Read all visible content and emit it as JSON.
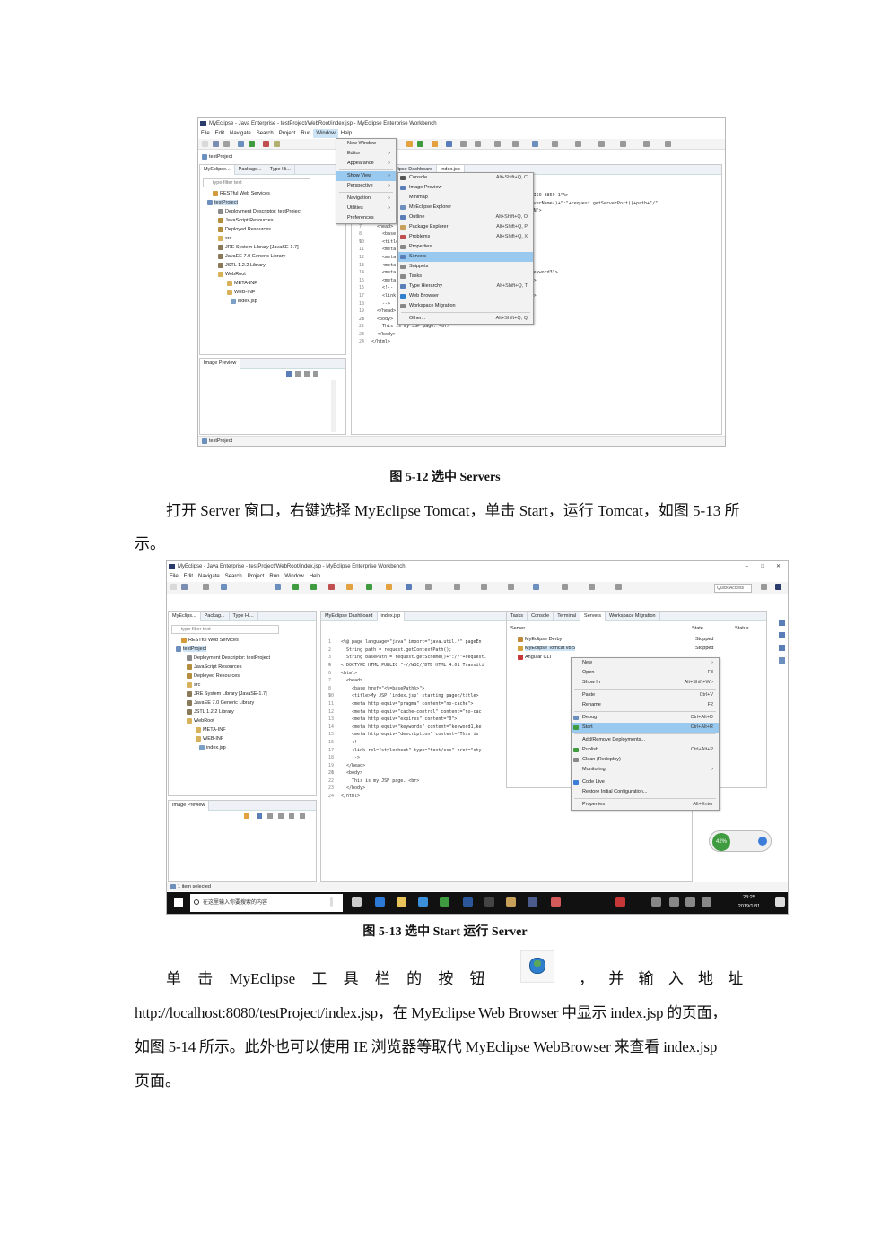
{
  "fig1": {
    "window_title": "MyEclipse - Java Enterprise - testProject/WebRoot/index.jsp - MyEclipse Enterprise Workbench",
    "menus": [
      "File",
      "Edit",
      "Navigate",
      "Search",
      "Project",
      "Run",
      "Window",
      "Help"
    ],
    "breadcrumb": "testProject",
    "explorer_tabs": [
      "MyEclipse...",
      "Package...",
      "Type Hi..."
    ],
    "filter_placeholder": "type filter text",
    "tree": [
      "RESTful Web Services",
      "testProject",
      "Deployment Descriptor: testProject",
      "JavaScript Resources",
      "Deployed Resources",
      "src",
      "JRE System Library [JavaSE-1.7]",
      "JavaEE 7.0 Generic Library",
      "JSTL 1.2.2 Library",
      "WebRoot",
      "META-INF",
      "WEB-INF",
      "index.jsp"
    ],
    "editor_tabs": [
      "...eclipse Dashboard",
      "index.jsp"
    ],
    "code_lines": [
      "<%@ page language=\"java\" import=\"java.util.*\" pageEncoding=\"ISO-8859-1\"%>",
      "",
      "  String basePath = request.getScheme()+\"://\"+request.getServerName()+\":\"+request.getServerPort()+path+\"/\";",
      "",
      "<!DOCTYPE HTML PUBLIC \"-//W3C//DTD HTML 4.01 Transitional//EN\">",
      "<html>",
      "  <head>",
      "    <base href=\"<%=basePath%>\">",
      "",
      "    <title>My JSP 'index.jsp' starting page</title>",
      "    <meta http-equiv=\"pragma\" content=\"no-cache\">",
      "    <meta http-equiv=\"cache-control\" content=\"no-cache\">",
      "    <meta http-equiv=\"expires\" content=\"0\">",
      "    <meta http-equiv=\"keywords\" content=\"keyword1,keyword2,keyword3\">",
      "    <meta http-equiv=\"description\" content=\"This is my page\">",
      "    <!--",
      "    <link rel=\"stylesheet\" type=\"text/css\" href=\"styles.css\">",
      "    -->",
      "  </head>",
      "",
      "  <body>",
      "    This is my JSP page. <br>",
      "  </body>",
      "</html>"
    ],
    "window_menu": [
      "New Window",
      "Editor",
      "Appearance",
      "Show View",
      "Perspective",
      "Navigation",
      "Utilities",
      "Preferences"
    ],
    "showview_menu": [
      {
        "label": "Console",
        "shortcut": "Alt+Shift+Q, C"
      },
      {
        "label": "Image Preview",
        "shortcut": ""
      },
      {
        "label": "Minimap",
        "shortcut": ""
      },
      {
        "label": "MyEclipse Explorer",
        "shortcut": ""
      },
      {
        "label": "Outline",
        "shortcut": "Alt+Shift+Q, O"
      },
      {
        "label": "Package Explorer",
        "shortcut": "Alt+Shift+Q, P"
      },
      {
        "label": "Problems",
        "shortcut": "Alt+Shift+Q, X"
      },
      {
        "label": "Properties",
        "shortcut": ""
      },
      {
        "label": "Servers",
        "shortcut": ""
      },
      {
        "label": "Snippets",
        "shortcut": ""
      },
      {
        "label": "Tasks",
        "shortcut": ""
      },
      {
        "label": "Type Hierarchy",
        "shortcut": "Alt+Shift+Q, T"
      },
      {
        "label": "Web Browser",
        "shortcut": ""
      },
      {
        "label": "Workspace Migration",
        "shortcut": ""
      },
      {
        "label": "Other...",
        "shortcut": "Alt+Shift+Q, Q"
      }
    ],
    "image_preview_tab": "Image Preview",
    "status_text": "testProject"
  },
  "caption1": "图 5-12 选中 Servers",
  "para1_line1": "打开 Server 窗口，右键选择 MyEclipse Tomcat，单击 Start，运行 Tomcat，如图 5-13 所",
  "para1_line2": "示。",
  "fig2": {
    "window_title": "MyEclipse - Java Enterprise - testProject/WebRoot/index.jsp - MyEclipse Enterprise Workbench",
    "menus": [
      "File",
      "Edit",
      "Navigate",
      "Search",
      "Project",
      "Run",
      "Window",
      "Help"
    ],
    "breadcrumb": "testProject",
    "quick_access": "Quick Access",
    "explorer_tabs": [
      "MyEclips...",
      "Packag...",
      "Type Hi..."
    ],
    "filter_placeholder": "type filter text",
    "tree": [
      "RESTful Web Services",
      "testProject",
      "Deployment Descriptor: testProject",
      "JavaScript Resources",
      "Deployed Resources",
      "src",
      "JRE System Library [JavaSE-1.7]",
      "JavaEE 7.0 Generic Library",
      "JSTL 1.2.2 Library",
      "WebRoot",
      "META-INF",
      "WEB-INF",
      "index.jsp"
    ],
    "editor_tabs": [
      "MyEclipse Dashboard",
      "index.jsp"
    ],
    "code_lines": [
      "<%@ page language=\"java\" import=\"java.util.*\" pageEn",
      "  String path = request.getContextPath();",
      "  String basePath = request.getScheme()+\"://\"+request.",
      "",
      "<!DOCTYPE HTML PUBLIC \"-//W3C//DTD HTML 4.01 Transiti",
      "<html>",
      "  <head>",
      "    <base href=\"<%=basePath%>\">",
      "",
      "    <title>My JSP 'index.jsp' starting page</title>",
      "    <meta http-equiv=\"pragma\" content=\"no-cache\">",
      "    <meta http-equiv=\"cache-control\" content=\"no-cac",
      "    <meta http-equiv=\"expires\" content=\"0\">",
      "    <meta http-equiv=\"keywords\" content=\"keyword1,ke",
      "    <meta http-equiv=\"description\" content=\"This is",
      "    <!--",
      "    <link rel=\"stylesheet\" type=\"text/css\" href=\"sty",
      "    -->",
      "  </head>",
      "",
      "  <body>",
      "    This is my JSP page. <br>",
      "  </body>",
      "</html>"
    ],
    "view_tabs": [
      "Tasks",
      "Console",
      "Terminal",
      "Servers",
      "Workspace Migration"
    ],
    "server_col_headers": [
      "Server",
      "State",
      "Status"
    ],
    "servers": [
      {
        "name": "MyEclipse Derby",
        "state": "Stopped"
      },
      {
        "name": "MyEclipse Tomcat v8.5",
        "state": "Stopped"
      },
      {
        "name": "Angular CLI",
        "state": ""
      }
    ],
    "context_menu": [
      {
        "label": "New",
        "shortcut": "›"
      },
      {
        "label": "Open",
        "shortcut": "F3"
      },
      {
        "label": "Show In",
        "shortcut": "Alt+Shift+W ›"
      },
      {
        "label": "Paste",
        "shortcut": "Ctrl+V"
      },
      {
        "label": "Rename",
        "shortcut": "F2"
      },
      {
        "label": "Debug",
        "shortcut": "Ctrl+Alt+D"
      },
      {
        "label": "Start",
        "shortcut": "Ctrl+Alt+R"
      },
      {
        "label": "Add/Remove Deployments...",
        "shortcut": ""
      },
      {
        "label": "Publish",
        "shortcut": "Ctrl+Alt+P"
      },
      {
        "label": "Clean (Redeploy)",
        "shortcut": ""
      },
      {
        "label": "Monitoring",
        "shortcut": "›"
      },
      {
        "label": "Code Live",
        "shortcut": ""
      },
      {
        "label": "Restore Initial Configuration...",
        "shortcut": ""
      },
      {
        "label": "Properties",
        "shortcut": "Alt+Enter"
      }
    ],
    "widget_percent": "42%",
    "image_preview_tab": "Image Preview",
    "status_text": "1 item selected",
    "taskbar_search": "在这里输入你要搜索的内容",
    "clock_time": "23:25",
    "clock_date": "2019/1/31"
  },
  "caption2": "图 5-13 选中 Start 运行 Server",
  "para2_line1_a": "单 击 MyEclipse 工 具 栏 的 按 钮",
  "para2_line1_b": "， 并 输 入 地 址",
  "para2_line2": "http://localhost:8080/testProject/index.jsp，在 MyEclipse Web Browser 中显示 index.jsp 的页面，",
  "para2_line3": "如图 5-14 所示。此外也可以使用 IE 浏览器等取代 MyEclipse WebBrowser 来查看 index.jsp",
  "para2_line4": "页面。",
  "colors": {
    "menu_highlight": "#99c9ef",
    "window_menu_highlight": "#cde4f7",
    "taskbar": "#111111"
  }
}
